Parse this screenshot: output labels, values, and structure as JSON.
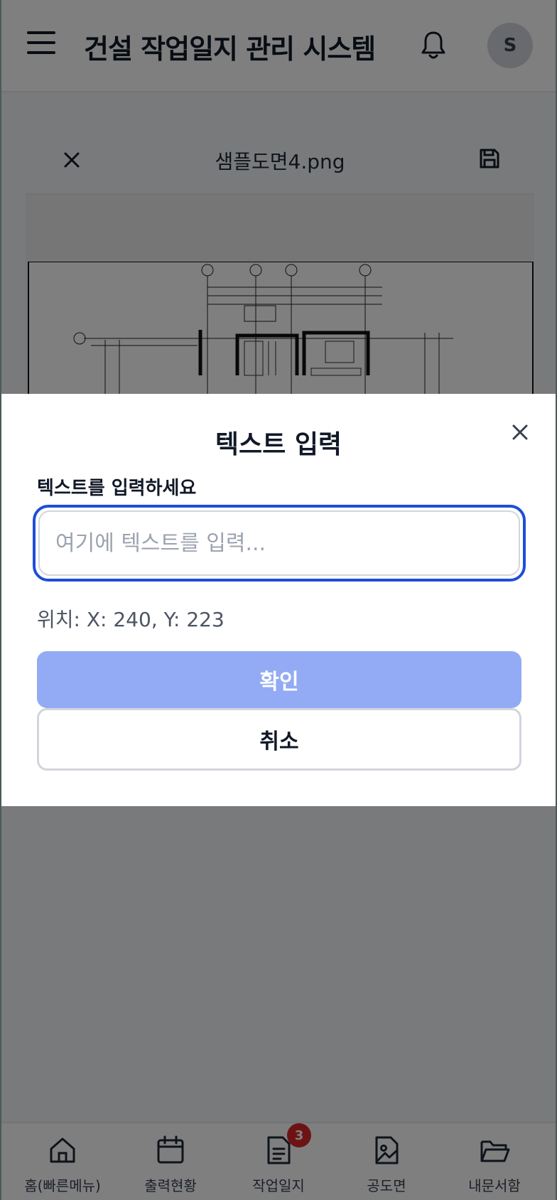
{
  "header": {
    "title": "건설 작업일지 관리 시스템",
    "avatar_initial": "S"
  },
  "viewer": {
    "filename": "샘플도면4.png"
  },
  "bottom_nav": {
    "items": [
      {
        "label": "홈(빠른메뉴)",
        "icon": "home-icon"
      },
      {
        "label": "출력현황",
        "icon": "calendar-icon"
      },
      {
        "label": "작업일지",
        "icon": "document-icon",
        "badge": "3"
      },
      {
        "label": "공도면",
        "icon": "image-file-icon"
      },
      {
        "label": "내문서함",
        "icon": "folder-icon"
      }
    ]
  },
  "modal": {
    "title": "텍스트 입력",
    "field_label": "텍스트를 입력하세요",
    "input_value": "",
    "input_placeholder": "여기에 텍스트를 입력...",
    "position_text": "위치: X: 240, Y: 223",
    "confirm_label": "확인",
    "cancel_label": "취소"
  },
  "colors": {
    "accent": "#1d4ed8",
    "confirm_disabled": "#93abf4",
    "badge": "#dc2626"
  }
}
